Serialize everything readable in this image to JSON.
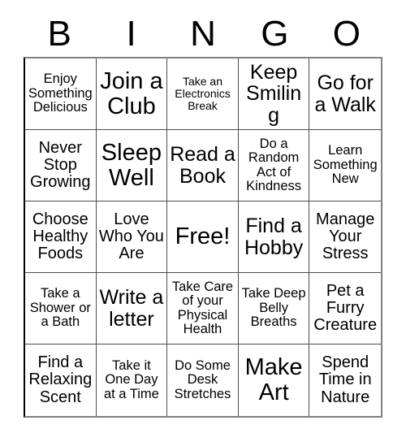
{
  "card": {
    "title_letters": [
      "B",
      "I",
      "N",
      "G",
      "O"
    ],
    "columns": 5,
    "rows": 5,
    "free_space_index": 12,
    "colors": {
      "background": "#ffffff",
      "text": "#000000",
      "grid_line": "#4d4d4d",
      "outer_border": "#808080"
    }
  },
  "cells": [
    {
      "text": "Enjoy Something Delicious",
      "size": "sm"
    },
    {
      "text": "Join a Club",
      "size": "xl"
    },
    {
      "text": "Take an Electronics Break",
      "size": "xs"
    },
    {
      "text": "Keep Smiling",
      "size": "lg"
    },
    {
      "text": "Go for a Walk",
      "size": "lg"
    },
    {
      "text": "Never Stop Growing",
      "size": "md"
    },
    {
      "text": "Sleep Well",
      "size": "xl"
    },
    {
      "text": "Read a Book",
      "size": "lg"
    },
    {
      "text": "Do a Random Act of Kindness",
      "size": "sm"
    },
    {
      "text": "Learn Something New",
      "size": "sm"
    },
    {
      "text": "Choose Healthy Foods",
      "size": "md"
    },
    {
      "text": "Love Who You Are",
      "size": "md"
    },
    {
      "text": "Free!",
      "size": "xl"
    },
    {
      "text": "Find a Hobby",
      "size": "lg"
    },
    {
      "text": "Manage Your Stress",
      "size": "md"
    },
    {
      "text": "Take a Shower or a Bath",
      "size": "sm"
    },
    {
      "text": "Write a letter",
      "size": "lg"
    },
    {
      "text": "Take Care of your Physical Health",
      "size": "sm"
    },
    {
      "text": "Take Deep Belly Breaths",
      "size": "sm"
    },
    {
      "text": "Pet a Furry Creature",
      "size": "md"
    },
    {
      "text": "Find a Relaxing Scent",
      "size": "md"
    },
    {
      "text": "Take it One Day at a Time",
      "size": "sm"
    },
    {
      "text": "Do Some Desk Stretches",
      "size": "sm"
    },
    {
      "text": "Make Art",
      "size": "xl"
    },
    {
      "text": "Spend Time in Nature",
      "size": "md"
    }
  ]
}
